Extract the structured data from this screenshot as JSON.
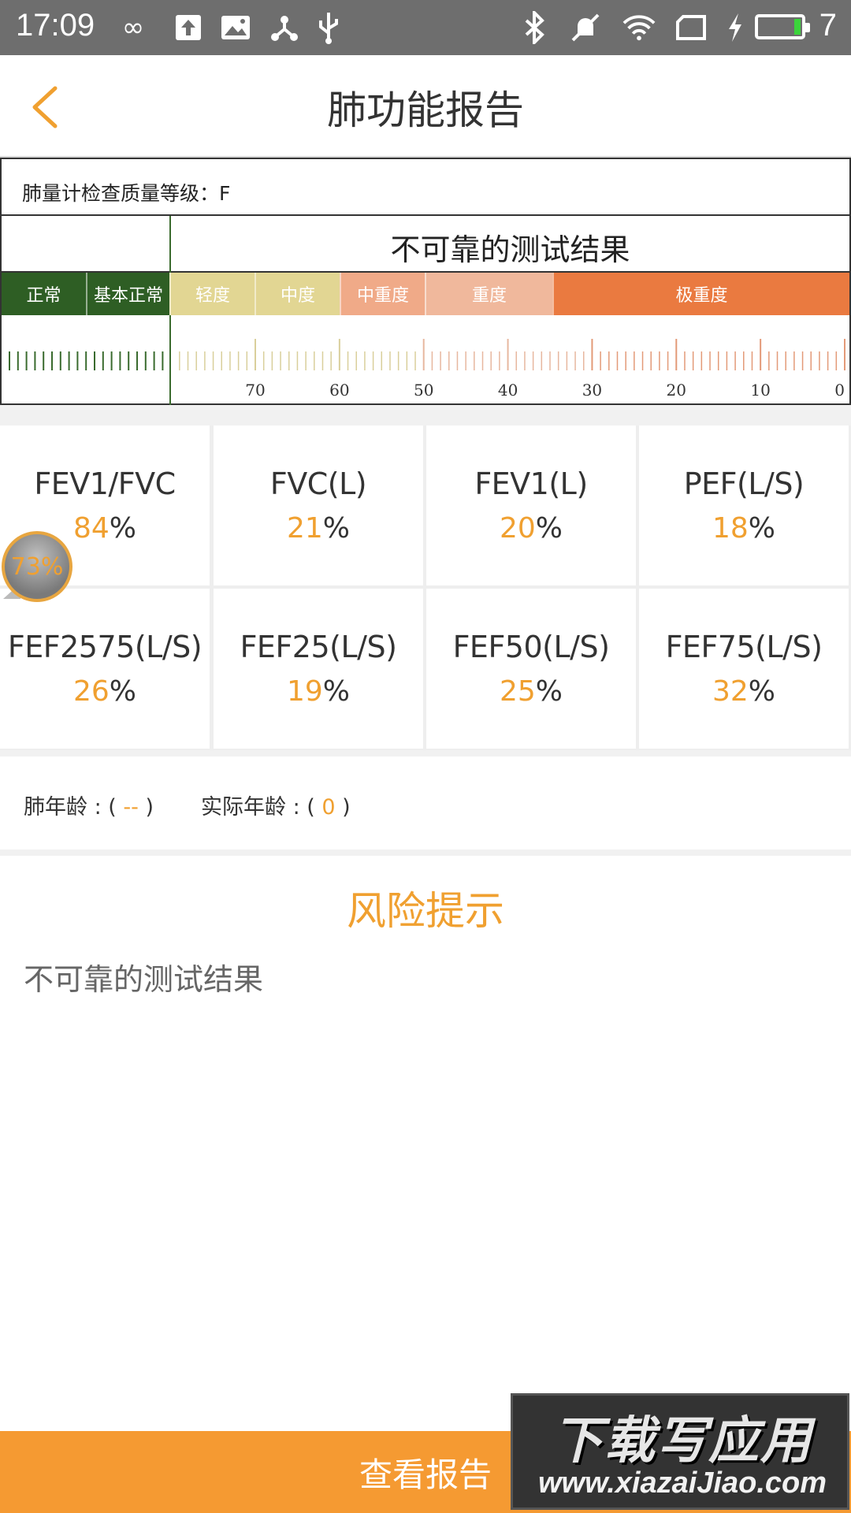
{
  "status_bar": {
    "time": "17:09",
    "battery_level": "7",
    "icons": [
      "infinity-icon",
      "upload-icon",
      "image-icon",
      "share-hub-icon",
      "usb-icon",
      "bluetooth-icon",
      "mute-icon",
      "wifi-icon",
      "screen-icon",
      "charging-icon",
      "battery-icon"
    ]
  },
  "header": {
    "title": "肺功能报告"
  },
  "quality": {
    "grade_label": "肺量计检查质量等级：F",
    "verdict": "不可靠的测试结果",
    "scale_segments": [
      "正常",
      "基本正常",
      "轻度",
      "中度",
      "中重度",
      "重度",
      "极重度"
    ],
    "scale_colors": [
      "#2e5e24",
      "#2e5e24",
      "#e2d693",
      "#e2d693",
      "#f0aa88",
      "#f0b89c",
      "#ea7a40"
    ],
    "tick_labels": [
      "70",
      "60",
      "50",
      "40",
      "30",
      "20",
      "10",
      "0"
    ]
  },
  "metrics": [
    {
      "label": "FEV1/FVC",
      "value": "84",
      "unit": "%"
    },
    {
      "label": "FVC(L)",
      "value": "21",
      "unit": "%"
    },
    {
      "label": "FEV1(L)",
      "value": "20",
      "unit": "%"
    },
    {
      "label": "PEF(L/S)",
      "value": "18",
      "unit": "%"
    },
    {
      "label": "FEF2575(L/S)",
      "value": "26",
      "unit": "%"
    },
    {
      "label": "FEF25(L/S)",
      "value": "19",
      "unit": "%"
    },
    {
      "label": "FEF50(L/S)",
      "value": "25",
      "unit": "%"
    },
    {
      "label": "FEF75(L/S)",
      "value": "32",
      "unit": "%"
    }
  ],
  "floating_bubble": "73%",
  "ages": {
    "lung_age_label": "肺年龄 : (",
    "lung_age_value": "--",
    "actual_age_label": "实际年龄 : (",
    "actual_age_value": "0",
    "close_paren": ")"
  },
  "risk": {
    "title": "风险提示",
    "text": "不可靠的测试结果"
  },
  "bottom_button": "查看报告",
  "watermark": {
    "big": "下载写应用",
    "url": "www.xiazaiJiao.com"
  }
}
